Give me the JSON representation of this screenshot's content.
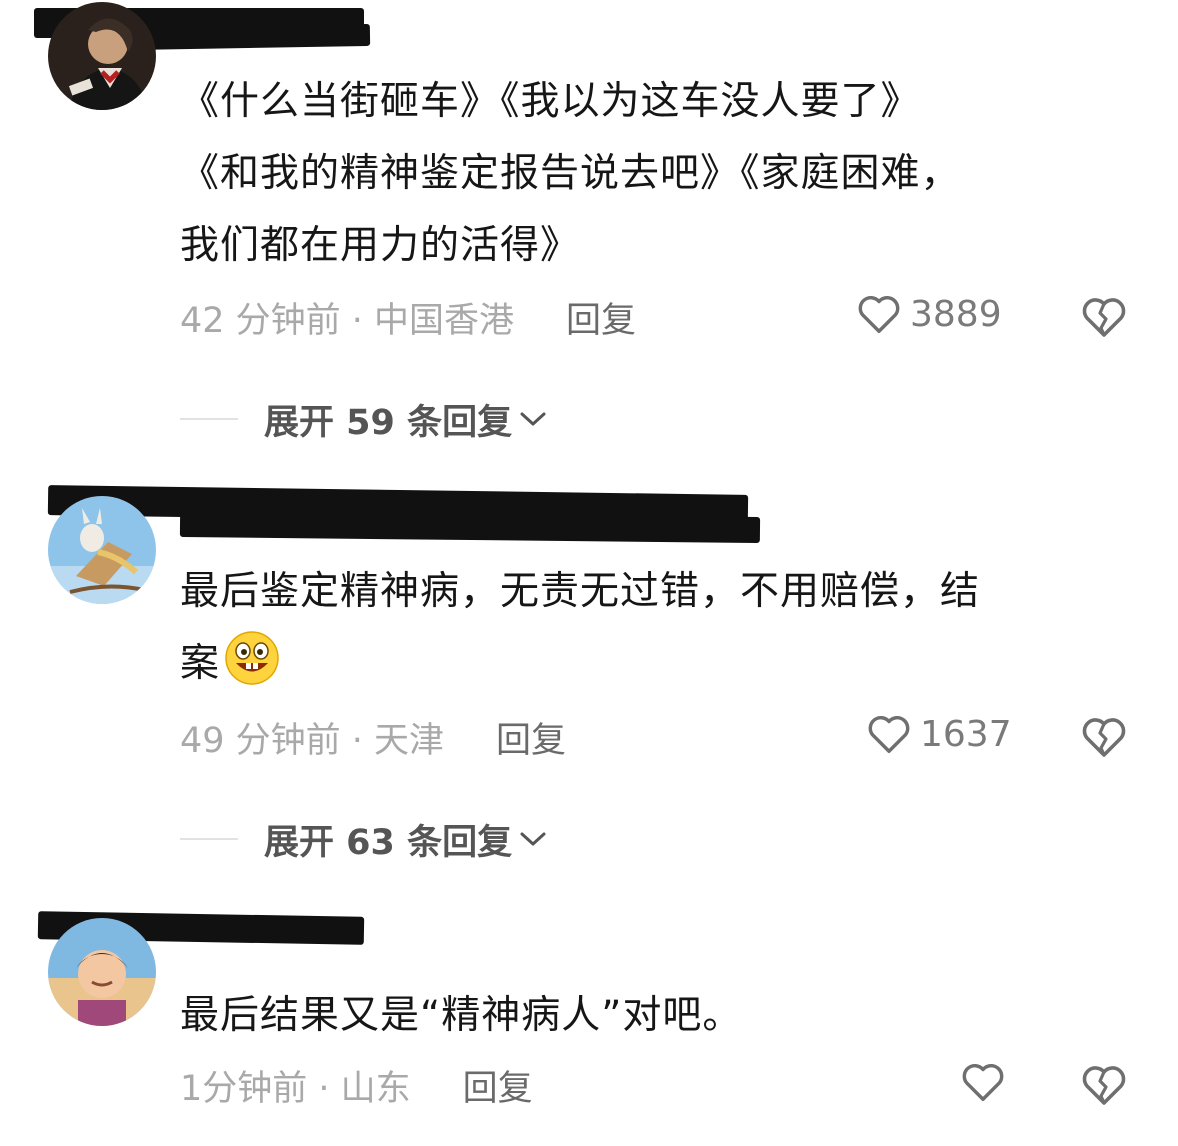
{
  "comments": [
    {
      "text_lines": [
        "《什么当街砸车》《我以为这车没人要了》",
        "《和我的精神鉴定报告说去吧》《家庭困难，",
        "我们都在用力的活得》"
      ],
      "time_location": "42 分钟前 · 中国香港",
      "reply_label": "回复",
      "likes": "3889",
      "expand_label": "展开 59 条回复"
    },
    {
      "text_lines": [
        "最后鉴定精神病，无责无过错，不用赔偿，结",
        "案"
      ],
      "time_location": "49 分钟前 · 天津",
      "reply_label": "回复",
      "likes": "1637",
      "expand_label": "展开 63 条回复"
    },
    {
      "text_lines": [
        "最后结果又是“精神病人”对吧。"
      ],
      "time_location": "1分钟前 · 山东",
      "reply_label": "回复",
      "likes": ""
    }
  ],
  "icons": {
    "like": "heart-outline-icon",
    "dislike": "broken-heart-icon",
    "expand": "chevron-down-icon",
    "emoji": "grinning-emoji-icon"
  },
  "colors": {
    "text": "#161616",
    "meta": "#a9a9a9",
    "redaction": "#111111"
  }
}
